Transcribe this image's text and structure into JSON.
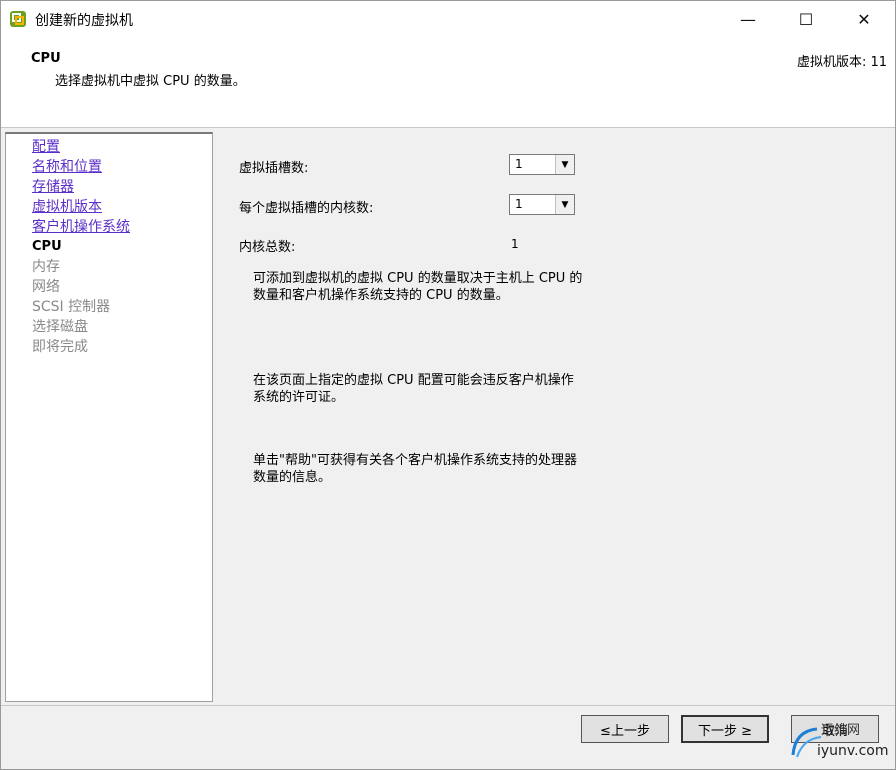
{
  "window": {
    "title": "创建新的虚拟机",
    "minimize_glyph": "—",
    "maximize_glyph": "☐",
    "close_glyph": "✕"
  },
  "header": {
    "title": "CPU",
    "subtitle": "选择虚拟机中虚拟 CPU 的数量。",
    "version_label": "虚拟机版本: 11"
  },
  "nav": {
    "items": [
      {
        "label": "配置",
        "state": "link"
      },
      {
        "label": "名称和位置",
        "state": "link"
      },
      {
        "label": "存储器",
        "state": "link"
      },
      {
        "label": "虚拟机版本",
        "state": "link"
      },
      {
        "label": "客户机操作系统",
        "state": "link"
      },
      {
        "label": "CPU",
        "state": "current"
      },
      {
        "label": "内存",
        "state": "pending"
      },
      {
        "label": "网络",
        "state": "pending"
      },
      {
        "label": "SCSI 控制器",
        "state": "pending"
      },
      {
        "label": "选择磁盘",
        "state": "pending"
      },
      {
        "label": "即将完成",
        "state": "pending"
      }
    ]
  },
  "form": {
    "sockets_label": "虚拟插槽数:",
    "sockets_value": "1",
    "cores_label": "每个虚拟插槽的内核数:",
    "cores_value": "1",
    "total_label": "内核总数:",
    "total_value": "1"
  },
  "info": {
    "para1": "可添加到虚拟机的虚拟 CPU 的数量取决于主机上 CPU 的数量和客户机操作系统支持的 CPU 的数量。",
    "para2": "在该页面上指定的虚拟 CPU 配置可能会违反客户机操作系统的许可证。",
    "para3": "单击\"帮助\"可获得有关各个客户机操作系统支持的处理器数量的信息。"
  },
  "buttons": {
    "back": "≤上一步",
    "next": "下一步 ≥",
    "cancel": "取消"
  },
  "watermark": {
    "line1": "运维网",
    "line2": "iyunv.com"
  },
  "colors": {
    "link": "#5b2fc7",
    "pending": "#8a8a8a",
    "window_bg": "#f0f0f0"
  }
}
